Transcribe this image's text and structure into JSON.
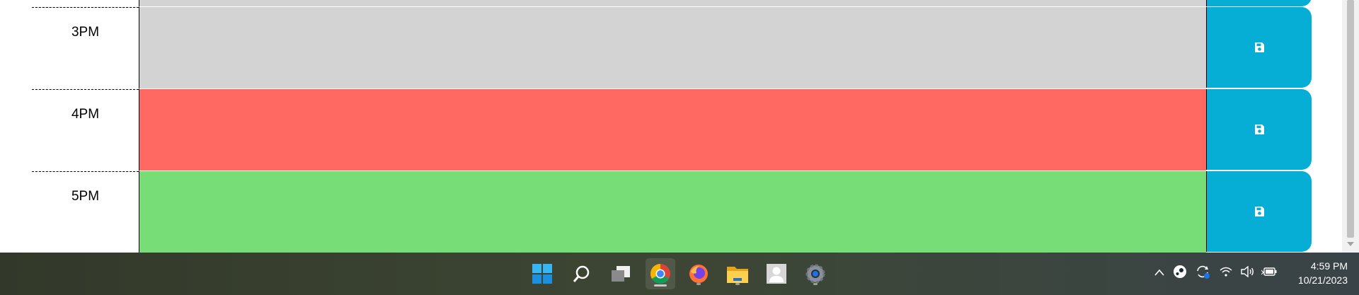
{
  "schedule": {
    "rows": [
      {
        "hour": "3PM",
        "status": "past",
        "color": "#d3d3d3"
      },
      {
        "hour": "4PM",
        "status": "present",
        "color": "#ff6961"
      },
      {
        "hour": "5PM",
        "status": "future",
        "color": "#77dd77"
      }
    ],
    "save_icon": "floppy-disk-icon",
    "save_color": "#06aed5"
  },
  "taskbar": {
    "icons": [
      "windows-start-icon",
      "search-icon",
      "task-view-icon",
      "chrome-icon",
      "firefox-icon",
      "file-explorer-icon",
      "contacts-icon",
      "settings-icon"
    ],
    "tray_icons": [
      "chevron-up-icon",
      "steam-icon",
      "sync-icon",
      "wifi-icon",
      "volume-icon",
      "battery-icon"
    ],
    "time": "4:59 PM",
    "date": "10/21/2023"
  }
}
